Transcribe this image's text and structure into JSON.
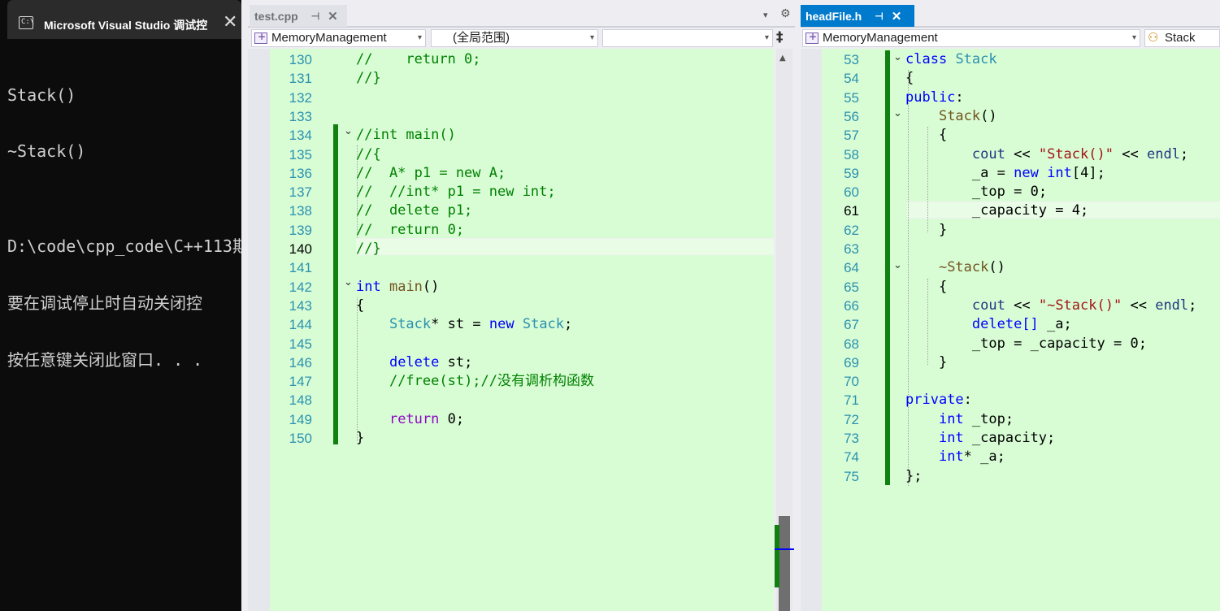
{
  "console": {
    "title": "Microsoft Visual Studio 调试控",
    "close": "✕",
    "lines": [
      "Stack()",
      "~Stack()",
      "",
      "D:\\code\\cpp_code\\C++113期",
      "要在调试停止时自动关闭控",
      "按任意键关闭此窗口. . ."
    ]
  },
  "left": {
    "tab_label": "test.cpp",
    "tab_pin": "⊣",
    "tab_close": "✕",
    "dropdown_arrow": "▾",
    "settings": "⚙",
    "split": "‡",
    "scope_dropdown": "MemoryManagement",
    "range_dropdown": "(全局范围)",
    "member_dropdown": "",
    "line_numbers": [
      "130",
      "131",
      "132",
      "133",
      "134",
      "135",
      "136",
      "137",
      "138",
      "139",
      "140",
      "141",
      "142",
      "143",
      "144",
      "145",
      "146",
      "147",
      "148",
      "149",
      "150"
    ],
    "lines": [
      "//    return 0;",
      "//}",
      "",
      "",
      "//int main()",
      "//{",
      "//  A* p1 = new A;",
      "//  //int* p1 = new int;",
      "//  delete p1;",
      "//  return 0;",
      "//}",
      "",
      "int main()",
      "{",
      "    Stack* st = new Stack;",
      "",
      "    delete st;",
      "    //free(st);//没有调析构函数",
      "",
      "    return 0;",
      "}"
    ]
  },
  "right": {
    "tab_label": "headFile.h",
    "tab_pin": "⊣",
    "tab_close": "✕",
    "scope_dropdown": "MemoryManagement",
    "member_dropdown": "Stack",
    "line_numbers": [
      "53",
      "54",
      "55",
      "56",
      "57",
      "58",
      "59",
      "60",
      "61",
      "62",
      "63",
      "64",
      "65",
      "66",
      "67",
      "68",
      "69",
      "70",
      "71",
      "72",
      "73",
      "74",
      "75"
    ],
    "lines": [
      "class Stack",
      "{",
      "public:",
      "    Stack()",
      "    {",
      "        cout << \"Stack()\" << endl;",
      "        _a = new int[4];",
      "        _top = 0;",
      "        _capacity = 4;",
      "    }",
      "",
      "    ~Stack()",
      "    {",
      "        cout << \"~Stack()\" << endl;",
      "        delete[] _a;",
      "        _top = _capacity = 0;",
      "    }",
      "",
      "private:",
      "    int _top;",
      "    int _capacity;",
      "    int* _a;",
      "};"
    ]
  },
  "colors": {
    "editor_bg": "#d8fdd5",
    "accent": "#007acc",
    "change_bar": "#108010",
    "keyword": "#0000ff",
    "type": "#2b91af",
    "comment": "#008000"
  }
}
